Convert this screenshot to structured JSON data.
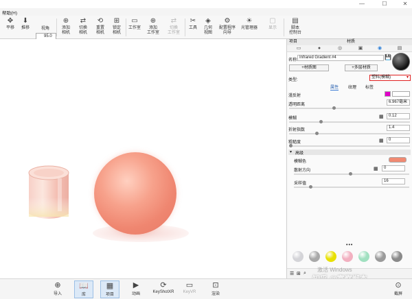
{
  "titlebar": {
    "minimize": "—",
    "maximize": "☐",
    "close": "✕"
  },
  "menu": {
    "help": "帮助(H)"
  },
  "toolbar": {
    "fov_value": "95.0",
    "items": [
      {
        "label1": "平移",
        "label2": "",
        "icon": "move-icon"
      },
      {
        "label1": "推移",
        "label2": "",
        "icon": "dolly-icon"
      },
      {
        "label1": "视角",
        "label2": "",
        "icon": "fov-icon"
      },
      {
        "label1": "添加",
        "label2": "相机",
        "icon": "add-camera-icon"
      },
      {
        "label1": "切换",
        "label2": "相机",
        "icon": "switch-camera-icon"
      },
      {
        "label1": "重置",
        "label2": "相机",
        "icon": "reset-camera-icon"
      },
      {
        "label1": "锁定",
        "label2": "相机",
        "icon": "lock-camera-icon"
      },
      {
        "label1": "工作室",
        "label2": "",
        "icon": "studio-icon"
      },
      {
        "label1": "添加",
        "label2": "工作室",
        "icon": "add-studio-icon"
      },
      {
        "label1": "切换",
        "label2": "工作室",
        "icon": "switch-studio-icon"
      },
      {
        "label1": "工具",
        "label2": "",
        "icon": "tools-icon"
      },
      {
        "label1": "几何",
        "label2": "视图",
        "icon": "geometry-view-icon"
      },
      {
        "label1": "配置程序",
        "label2": "向导",
        "icon": "configurator-icon"
      },
      {
        "label1": "光管理器",
        "label2": "",
        "icon": "light-manager-icon"
      },
      {
        "label1": "显示",
        "label2": "",
        "icon": "display-icon"
      },
      {
        "label1": "脚本",
        "label2": "控制台",
        "icon": "script-console-icon"
      }
    ]
  },
  "bottom_toolbar": [
    {
      "label": "导入",
      "icon": "import-icon"
    },
    {
      "label": "库",
      "icon": "library-icon"
    },
    {
      "label": "项目",
      "icon": "project-icon"
    },
    {
      "label": "动画",
      "icon": "animation-icon"
    },
    {
      "label": "KeyShotXR",
      "icon": "keyshotxr-icon"
    },
    {
      "label": "KeyVR",
      "icon": "keyvr-icon"
    },
    {
      "label": "渲染",
      "icon": "render-icon"
    },
    {
      "label": "截屏",
      "icon": "screenshot-icon"
    }
  ],
  "panel": {
    "left_title": "项目",
    "title": "材质",
    "name_label": "名称:",
    "name_value": "Infrared Gradient #4",
    "multi_layer_btn": "多层材质",
    "to_library_btn": "材质图",
    "type_label": "类型:",
    "type_value": "塑料(模糊)",
    "subtabs": [
      "属性",
      "纹理",
      "标签"
    ],
    "props": {
      "diffuse_label": "漫反射",
      "transmission_label": "透明距离",
      "transmission_value": "6.967毫米",
      "blur_label": "模糊",
      "blur_value": "0.12",
      "ior_label": "折射指数",
      "ior_value": "1.4",
      "roughness_label": "粗糙度",
      "roughness_value": "0",
      "advanced_label": "高级",
      "blur_color_label": "模糊色",
      "scatter_label": "散射方向",
      "scatter_value": "0",
      "samples_label": "采样值",
      "samples_value": "16"
    },
    "colors": {
      "diffuse": "#e000c8",
      "blur_color": "#f08a72",
      "accent": "#3a7bd5"
    },
    "material_balls": [
      "#d4d4d8",
      "#a8a8a8",
      "#e8e000",
      "#f2b0c0",
      "#a0e0c0",
      "#9a9a9a",
      "#8a8a8a"
    ]
  },
  "watermark": {
    "activate": "激活 Windows",
    "zhihu": "知乎 @富察郸杰"
  }
}
